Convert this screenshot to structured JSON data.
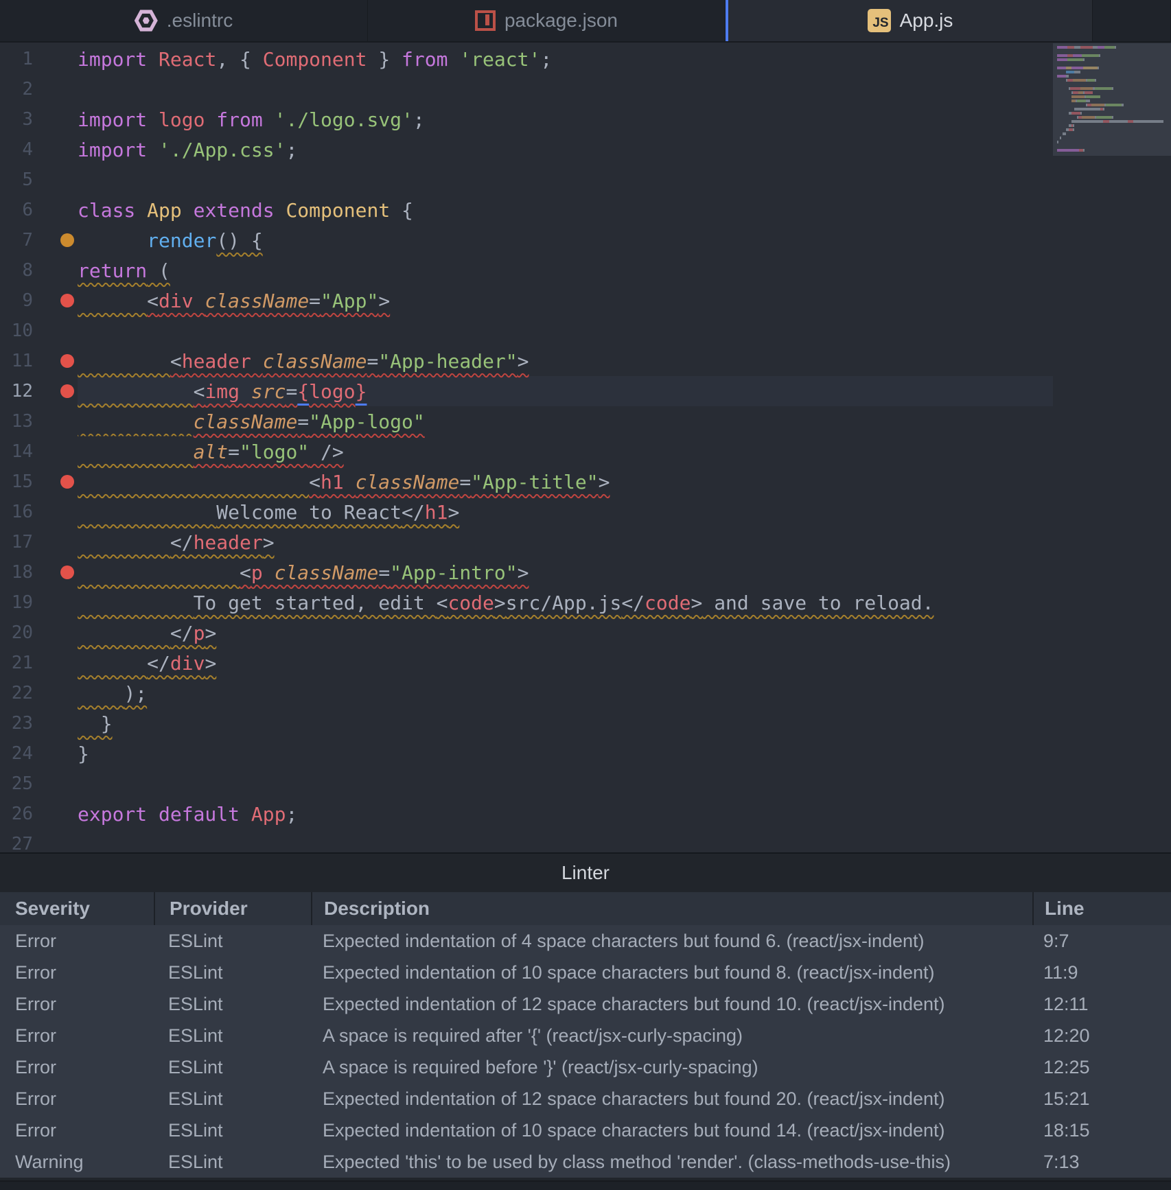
{
  "colors": {
    "accent_blue": "#4e7cf0",
    "error_red": "#e3524a",
    "warning_orange": "#cc8b2e",
    "squiggle_orange": "#a5802c",
    "squiggle_red": "#bf4540",
    "keyword": "#c678dd",
    "tag": "#e06c75",
    "class": "#e5c07b",
    "string": "#98c379",
    "function": "#61afef",
    "attribute": "#d19a66",
    "plain": "#abb2bf"
  },
  "tabs": [
    {
      "label": ".eslintrc",
      "icon": "eslint-icon",
      "active": false
    },
    {
      "label": "package.json",
      "icon": "npm-icon",
      "active": false
    },
    {
      "label": "App.js",
      "icon": "js-icon",
      "badge": "JS",
      "active": true
    }
  ],
  "editor": {
    "lines": [
      {
        "n": 1,
        "dot": null,
        "active": false,
        "tokens": [
          [
            "import ",
            "kw"
          ],
          [
            "React",
            "ent"
          ],
          [
            ", ",
            "pun"
          ],
          [
            "{ ",
            "pun"
          ],
          [
            "Component",
            "ent"
          ],
          [
            " } ",
            "pun"
          ],
          [
            "from ",
            "kw"
          ],
          [
            "'react'",
            "str"
          ],
          [
            ";",
            "pun"
          ]
        ]
      },
      {
        "n": 2,
        "dot": null,
        "active": false,
        "tokens": []
      },
      {
        "n": 3,
        "dot": null,
        "active": false,
        "tokens": [
          [
            "import ",
            "kw"
          ],
          [
            "logo",
            "ent"
          ],
          [
            " from ",
            "kw"
          ],
          [
            "'./logo.svg'",
            "str"
          ],
          [
            ";",
            "pun"
          ]
        ]
      },
      {
        "n": 4,
        "dot": null,
        "active": false,
        "tokens": [
          [
            "import ",
            "kw"
          ],
          [
            "'./App.css'",
            "str"
          ],
          [
            ";",
            "pun"
          ]
        ]
      },
      {
        "n": 5,
        "dot": null,
        "active": false,
        "tokens": []
      },
      {
        "n": 6,
        "dot": null,
        "active": false,
        "tokens": [
          [
            "class ",
            "kw"
          ],
          [
            "App ",
            "cls"
          ],
          [
            "extends ",
            "kw"
          ],
          [
            "Component ",
            "cls"
          ],
          [
            "{",
            "pun"
          ]
        ]
      },
      {
        "n": 7,
        "dot": "orange",
        "active": false,
        "tokens": [
          [
            "      ",
            "pun"
          ],
          [
            "render",
            "fn"
          ],
          [
            "() {",
            "pun sqo"
          ]
        ]
      },
      {
        "n": 8,
        "dot": null,
        "active": false,
        "tokens": [
          [
            "return",
            "kw sqo"
          ],
          [
            " (",
            "pun sqo"
          ]
        ]
      },
      {
        "n": 9,
        "dot": "red",
        "active": false,
        "tokens": [
          [
            "      ",
            "pun sqo"
          ],
          [
            "<",
            "pun sqr"
          ],
          [
            "div ",
            "ent sqr"
          ],
          [
            "className",
            "attr sqr"
          ],
          [
            "=",
            "pun sqr"
          ],
          [
            "\"App\"",
            "str sqr"
          ],
          [
            ">",
            "pun sqr"
          ]
        ]
      },
      {
        "n": 10,
        "dot": null,
        "active": false,
        "tokens": []
      },
      {
        "n": 11,
        "dot": "red",
        "active": false,
        "tokens": [
          [
            "        ",
            "pun sqo"
          ],
          [
            "<",
            "pun sqr"
          ],
          [
            "header ",
            "ent sqr"
          ],
          [
            "className",
            "attr sqr"
          ],
          [
            "=",
            "pun sqr"
          ],
          [
            "\"App-header\"",
            "str sqr"
          ],
          [
            ">",
            "pun sqr"
          ]
        ]
      },
      {
        "n": 12,
        "dot": "red",
        "active": true,
        "tokens": [
          [
            "          ",
            "pun sqo"
          ],
          [
            "<",
            "pun sqr"
          ],
          [
            "img ",
            "ent sqr"
          ],
          [
            "src",
            "attr sqr"
          ],
          [
            "=",
            "pun sqr"
          ],
          [
            "{",
            "ent sqb"
          ],
          [
            "logo",
            "ent sqr"
          ],
          [
            "}",
            "ent sqb"
          ]
        ]
      },
      {
        "n": 13,
        "dot": null,
        "active": false,
        "tokens": [
          [
            "          ",
            "pun sqo"
          ],
          [
            "className",
            "attr sqr"
          ],
          [
            "=",
            "pun sqr"
          ],
          [
            "\"App-logo\"",
            "str sqr"
          ]
        ]
      },
      {
        "n": 14,
        "dot": null,
        "active": false,
        "tokens": [
          [
            "          ",
            "pun sqo"
          ],
          [
            "alt",
            "attr sqr"
          ],
          [
            "=",
            "pun sqr"
          ],
          [
            "\"logo\"",
            "str sqr"
          ],
          [
            " />",
            "pun sqr"
          ]
        ]
      },
      {
        "n": 15,
        "dot": "red",
        "active": false,
        "tokens": [
          [
            "                    ",
            "pun sqo"
          ],
          [
            "<",
            "pun sqr"
          ],
          [
            "h1 ",
            "ent sqr"
          ],
          [
            "className",
            "attr sqr"
          ],
          [
            "=",
            "pun sqr"
          ],
          [
            "\"App-title\"",
            "str sqr"
          ],
          [
            ">",
            "pun sqr"
          ]
        ]
      },
      {
        "n": 16,
        "dot": null,
        "active": false,
        "tokens": [
          [
            "            ",
            "pun sqo"
          ],
          [
            "Welcome to React",
            "txt sqo"
          ],
          [
            "</",
            "pun sqo"
          ],
          [
            "h1",
            "ent sqo"
          ],
          [
            ">",
            "pun sqo"
          ]
        ]
      },
      {
        "n": 17,
        "dot": null,
        "active": false,
        "tokens": [
          [
            "        ",
            "pun sqo"
          ],
          [
            "</",
            "pun sqo"
          ],
          [
            "header",
            "ent sqo"
          ],
          [
            ">",
            "pun sqo"
          ]
        ]
      },
      {
        "n": 18,
        "dot": "red",
        "active": false,
        "tokens": [
          [
            "              ",
            "pun sqo"
          ],
          [
            "<",
            "pun sqr"
          ],
          [
            "p ",
            "ent sqr"
          ],
          [
            "className",
            "attr sqr"
          ],
          [
            "=",
            "pun sqr"
          ],
          [
            "\"App-intro\"",
            "str sqr"
          ],
          [
            ">",
            "pun sqr"
          ]
        ]
      },
      {
        "n": 19,
        "dot": null,
        "active": false,
        "tokens": [
          [
            "          ",
            "pun sqo"
          ],
          [
            "To get started, edit ",
            "txt sqo"
          ],
          [
            "<",
            "pun sqo"
          ],
          [
            "code",
            "ent sqo"
          ],
          [
            ">",
            "pun sqo"
          ],
          [
            "src/App.js",
            "txt sqo"
          ],
          [
            "</",
            "pun sqo"
          ],
          [
            "code",
            "ent sqo"
          ],
          [
            ">",
            "pun sqo"
          ],
          [
            " and save to reload.",
            "txt sqo"
          ]
        ]
      },
      {
        "n": 20,
        "dot": null,
        "active": false,
        "tokens": [
          [
            "        ",
            "pun sqo"
          ],
          [
            "</",
            "pun sqo"
          ],
          [
            "p",
            "ent sqo"
          ],
          [
            ">",
            "pun sqo"
          ]
        ]
      },
      {
        "n": 21,
        "dot": null,
        "active": false,
        "tokens": [
          [
            "      ",
            "pun sqo"
          ],
          [
            "</",
            "pun sqo"
          ],
          [
            "div",
            "ent sqo"
          ],
          [
            ">",
            "pun sqo"
          ]
        ]
      },
      {
        "n": 22,
        "dot": null,
        "active": false,
        "tokens": [
          [
            "    ",
            "pun sqo"
          ],
          [
            ");",
            "pun sqo"
          ]
        ]
      },
      {
        "n": 23,
        "dot": null,
        "active": false,
        "tokens": [
          [
            "  ",
            "pun sqo"
          ],
          [
            "}",
            "pun sqo"
          ]
        ]
      },
      {
        "n": 24,
        "dot": null,
        "active": false,
        "tokens": [
          [
            "}",
            "pun"
          ]
        ]
      },
      {
        "n": 25,
        "dot": null,
        "active": false,
        "tokens": []
      },
      {
        "n": 26,
        "dot": null,
        "active": false,
        "tokens": [
          [
            "export default ",
            "kw"
          ],
          [
            "App",
            "ent"
          ],
          [
            ";",
            "pun"
          ]
        ]
      },
      {
        "n": 27,
        "dot": null,
        "active": false,
        "tokens": []
      }
    ]
  },
  "linter": {
    "title": "Linter",
    "columns": [
      "Severity",
      "Provider",
      "Description",
      "Line"
    ],
    "rows": [
      {
        "severity": "Error",
        "provider": "ESLint",
        "description": "Expected indentation of 4 space characters but found 6. (react/jsx-indent)",
        "line": "9:7"
      },
      {
        "severity": "Error",
        "provider": "ESLint",
        "description": "Expected indentation of 10 space characters but found 8. (react/jsx-indent)",
        "line": "11:9"
      },
      {
        "severity": "Error",
        "provider": "ESLint",
        "description": "Expected indentation of 12 space characters but found 10. (react/jsx-indent)",
        "line": "12:11"
      },
      {
        "severity": "Error",
        "provider": "ESLint",
        "description": "A space is required after '{' (react/jsx-curly-spacing)",
        "line": "12:20"
      },
      {
        "severity": "Error",
        "provider": "ESLint",
        "description": "A space is required before '}' (react/jsx-curly-spacing)",
        "line": "12:25"
      },
      {
        "severity": "Error",
        "provider": "ESLint",
        "description": "Expected indentation of 12 space characters but found 20. (react/jsx-indent)",
        "line": "15:21"
      },
      {
        "severity": "Error",
        "provider": "ESLint",
        "description": "Expected indentation of 10 space characters but found 14. (react/jsx-indent)",
        "line": "18:15"
      },
      {
        "severity": "Warning",
        "provider": "ESLint",
        "description": "Expected 'this' to be used by class method 'render'. (class-methods-use-this)",
        "line": "7:13"
      }
    ]
  }
}
